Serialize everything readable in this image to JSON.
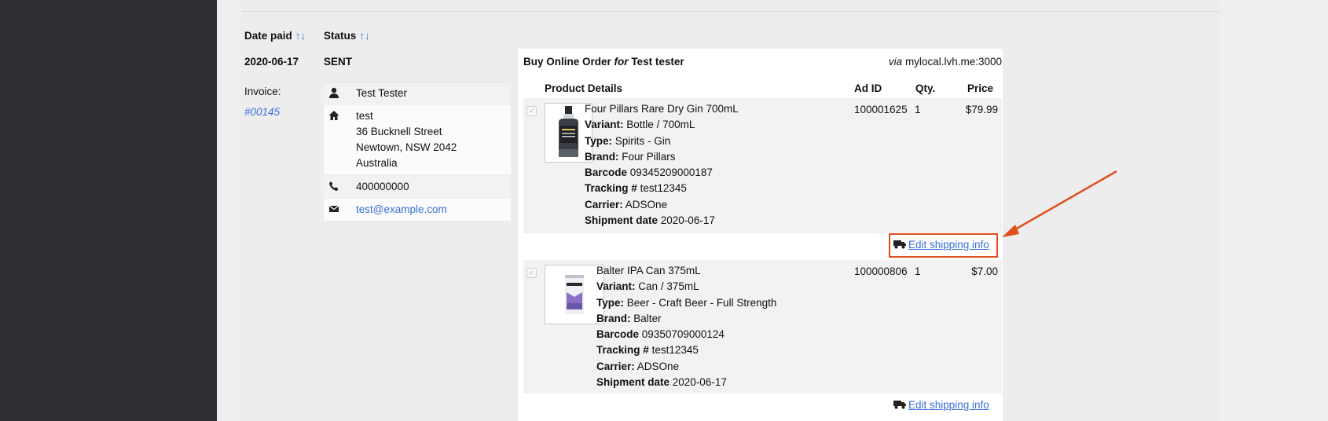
{
  "table": {
    "headers": {
      "date_paid": "Date paid",
      "status": "Status",
      "sort_arrows": "↑↓"
    }
  },
  "order": {
    "date_paid": "2020-06-17",
    "status": "SENT",
    "invoice_label": "Invoice:",
    "invoice_number": "#00145",
    "contact": {
      "name": "Test Tester",
      "address": [
        "test",
        "36 Bucknell Street",
        "Newtown, NSW 2042",
        "Australia"
      ],
      "phone": "400000000",
      "email": "test@example.com"
    },
    "title_prefix": "Buy Online Order",
    "title_for": "for",
    "customer": "Test tester",
    "via_label": "via",
    "via_host": "mylocal.lvh.me:3000"
  },
  "products": {
    "headers": {
      "details": "Product Details",
      "ad_id": "Ad ID",
      "qty": "Qty.",
      "price": "Price"
    },
    "edit_shipping_label": "Edit shipping info",
    "items": [
      {
        "name": "Four Pillars Rare Dry Gin 700mL",
        "variant_label": "Variant:",
        "variant": "Bottle / 700mL",
        "type_label": "Type:",
        "type": "Spirits - Gin",
        "brand_label": "Brand:",
        "brand": "Four Pillars",
        "barcode_label": "Barcode",
        "barcode": "09345209000187",
        "tracking_label": "Tracking #",
        "tracking": "test12345",
        "carrier_label": "Carrier:",
        "carrier": "ADSOne",
        "shipment_label": "Shipment date",
        "shipment_date": "2020-06-17",
        "ad_id": "100001625",
        "qty": "1",
        "price": "$79.99"
      },
      {
        "name": "Balter IPA Can 375mL",
        "variant_label": "Variant:",
        "variant": "Can / 375mL",
        "type_label": "Type:",
        "type": "Beer - Craft Beer - Full Strength",
        "brand_label": "Brand:",
        "brand": "Balter",
        "barcode_label": "Barcode",
        "barcode": "09350709000124",
        "tracking_label": "Tracking #",
        "tracking": "test12345",
        "carrier_label": "Carrier:",
        "carrier": "ADSOne",
        "shipment_label": "Shipment date",
        "shipment_date": "2020-06-17",
        "ad_id": "100000806",
        "qty": "1",
        "price": "$7.00"
      }
    ]
  },
  "icons": {
    "person": "person-icon",
    "home": "home-icon",
    "phone": "phone-icon",
    "mail": "envelope-icon",
    "truck": "truck-icon"
  },
  "colors": {
    "link": "#3b6fd8",
    "annotation": "#e04e1d",
    "sidebar": "#2f3033"
  }
}
